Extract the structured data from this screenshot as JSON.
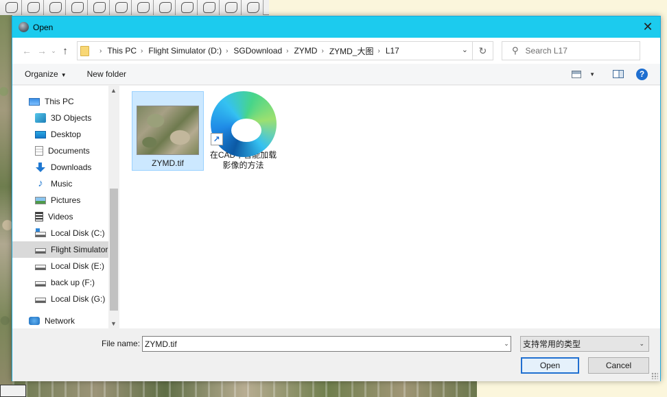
{
  "dialog": {
    "title": "Open",
    "close_glyph": "✕"
  },
  "address": {
    "crumbs": [
      "This PC",
      "Flight Simulator (D:)",
      "SGDownload",
      "ZYMD",
      "ZYMD_大图",
      "L17"
    ],
    "search_placeholder": "Search L17"
  },
  "commands": {
    "organize": "Organize",
    "new_folder": "New folder"
  },
  "nav": {
    "items": [
      {
        "label": "This PC",
        "icon": "pc-icon"
      },
      {
        "label": "3D Objects",
        "icon": "3d-objects-icon"
      },
      {
        "label": "Desktop",
        "icon": "desktop-icon"
      },
      {
        "label": "Documents",
        "icon": "documents-icon"
      },
      {
        "label": "Downloads",
        "icon": "downloads-icon"
      },
      {
        "label": "Music",
        "icon": "music-icon"
      },
      {
        "label": "Pictures",
        "icon": "pictures-icon"
      },
      {
        "label": "Videos",
        "icon": "videos-icon"
      },
      {
        "label": "Local Disk (C:)",
        "icon": "drive-icon"
      },
      {
        "label": "Flight Simulator",
        "icon": "drive-icon",
        "selected": true
      },
      {
        "label": "Local Disk (E:)",
        "icon": "drive-icon"
      },
      {
        "label": "back up (F:)",
        "icon": "drive-icon"
      },
      {
        "label": "Local Disk (G:)",
        "icon": "drive-icon"
      },
      {
        "label": "Network",
        "icon": "network-icon"
      }
    ]
  },
  "files": [
    {
      "name": "ZYMD.tif",
      "selected": true
    },
    {
      "name": "在CAD中智能加载影像的方法",
      "icon": "edge-shortcut-icon"
    }
  ],
  "bottom": {
    "filename_label": "File name:",
    "filename_value": "ZYMD.tif",
    "file_type": "支持常用的类型",
    "open_label": "Open",
    "cancel_label": "Cancel"
  },
  "colors": {
    "title_bar": "#1ccbee",
    "selection": "#cce8ff",
    "accent": "#1f6fd0"
  }
}
